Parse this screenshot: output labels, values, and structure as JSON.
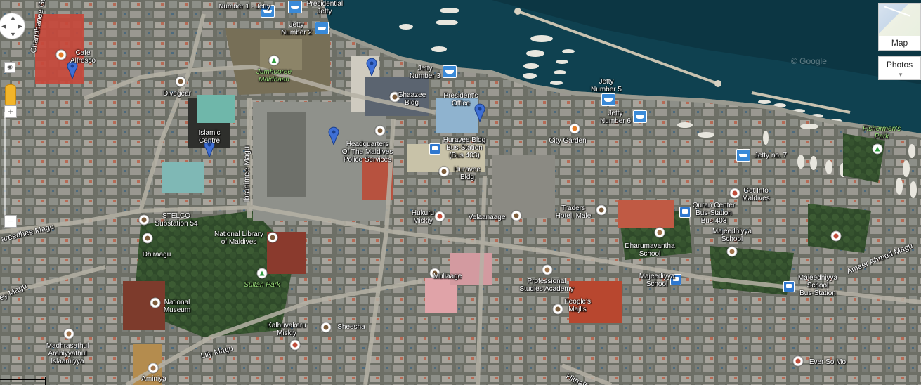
{
  "map_type": "satellite",
  "colors": {
    "sea": "#0d3d4d",
    "land": "#6a6c62",
    "pin": "#3e6fd6",
    "ferry": "#3a8ad8",
    "bus": "#2f78d0",
    "green_label": "#9be07a"
  },
  "controls": {
    "map_label": "Map",
    "photos_label": "Photos",
    "zoom_in": "+",
    "zoom_out": "−",
    "pegman_icon": "pegman-icon",
    "pan_icon": "pan-control-icon"
  },
  "watermark": "© Google",
  "labels": {
    "number1_jetty": "Number 1 - Jetty",
    "presidential_jetty": "Presidential\nJetty",
    "jetty_number2": "Jetty\nNumber 2",
    "jetty_number3": "Jetty\nNumber 3",
    "jetty_number5": "Jetty\nNumber 5",
    "jetty_number6": "Jetty\nNumber 6",
    "jetty_no7": "Jetty no. 7",
    "fishermens_park": "Fishermen's\nPark",
    "cafe_alfresco": "Cafe\nAlfresco",
    "jumhooree_maidhaan": "Jumhooree\nMaidhaan",
    "ghaazee_bldg": "Ghaazee\nBldg",
    "presidents_office": "President's\nOffice",
    "divegear": "Divegear",
    "islamic_centre": "Islamic\nCentre",
    "police_hq": "Headquarters\nOf The Maldives\nPolice Services",
    "huravee_busstation": "Huravee Bldg\nBus-Station\n(Bus 403)",
    "huravee_bldg": "Huravee\nBldg",
    "city_garden": "City Garden",
    "get_into_maldives": "Get Into\nMaldives",
    "quran_center": "Quran Center\nBus-Station\nBus 403",
    "majeedhiyya_school": "Majeedhiyya\nSchool",
    "dharumavantha_school": "Dharumavantha\nSchool",
    "traders_hotel": "Traders\nHotel, Male",
    "hukuru_miskiy": "Hukuru\nMiskiy",
    "velaanaage": "Velaanaage",
    "stelco": "STELCO\nSubstation 54",
    "national_library": "National Library\nof Maldives",
    "dhiraagu": "Dhiraagu",
    "sultan_park": "Sultan Park",
    "national_museum": "National\nMuseum",
    "muliaage": "Muliaage",
    "professional_studies": "Professional\nStudies Academy",
    "peoples_majlis": "People's\nMajlis",
    "majeediyya_school": "Majeediyya\nSchool",
    "majeedhiyya_busstation": "Majeedhiyya\nSchool\nBus-Station",
    "kalhuvakaru_miskiy": "Kalhuvakaru\nMiskiy",
    "sheesha": "Sheesha",
    "madhrasathul": "Madhrasathul\nArabiyyathul\nIslaamiyya",
    "aminiya": "Aminiya",
    "ever_so_mo": "Ever So Mo"
  },
  "roads": {
    "ibrahimee_magu": "Ibrahimee Magu",
    "lily_magu": "Lily Magu",
    "ameer_ahmed_magu": "Ameer Ahmed Magu",
    "fareedhee_magu": "areedhee Magu",
    "chandhanee_goalhi": "Chandhanee Goalhi",
    "ey_magu": "ey Magu",
    "hithaffinivaa": "Hithaffin"
  },
  "pins": [
    "cafe-pin",
    "ghaazee-pin",
    "presidents-office-pin",
    "islamic-centre-pin",
    "police-hq-pin"
  ]
}
